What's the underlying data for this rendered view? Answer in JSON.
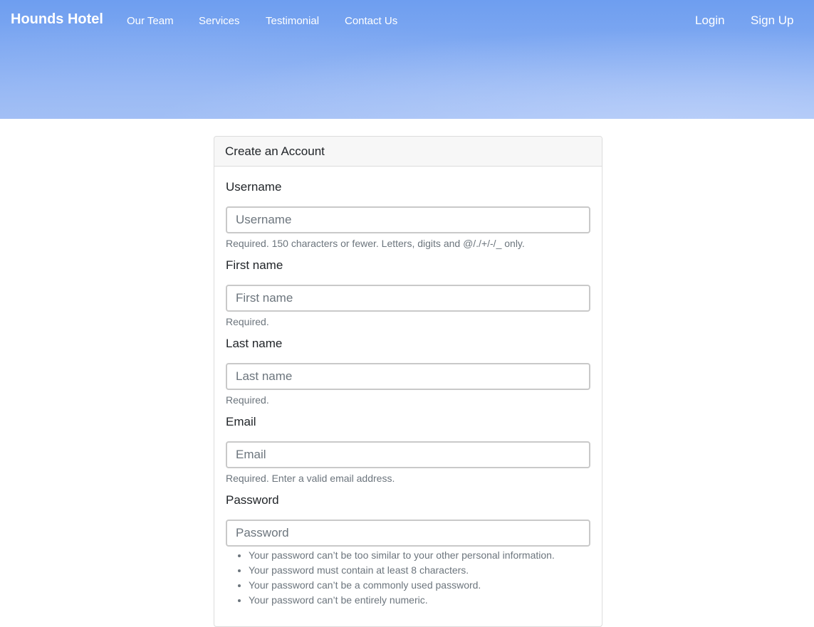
{
  "navbar": {
    "brand": "Hounds Hotel",
    "links": [
      "Our Team",
      "Services",
      "Testimonial",
      "Contact Us"
    ],
    "login": "Login",
    "signup": "Sign Up"
  },
  "form": {
    "title": "Create an Account",
    "username": {
      "label": "Username",
      "placeholder": "Username",
      "help": "Required. 150 characters or fewer. Letters, digits and @/./+/-/_ only."
    },
    "first_name": {
      "label": "First name",
      "placeholder": "First name",
      "help": "Required."
    },
    "last_name": {
      "label": "Last name",
      "placeholder": "Last name",
      "help": "Required."
    },
    "email": {
      "label": "Email",
      "placeholder": "Email",
      "help": "Required. Enter a valid email address."
    },
    "password": {
      "label": "Password",
      "placeholder": "Password",
      "help_items": [
        "Your password can’t be too similar to your other personal information.",
        "Your password must contain at least 8 characters.",
        "Your password can’t be a commonly used password.",
        "Your password can’t be entirely numeric."
      ]
    }
  }
}
